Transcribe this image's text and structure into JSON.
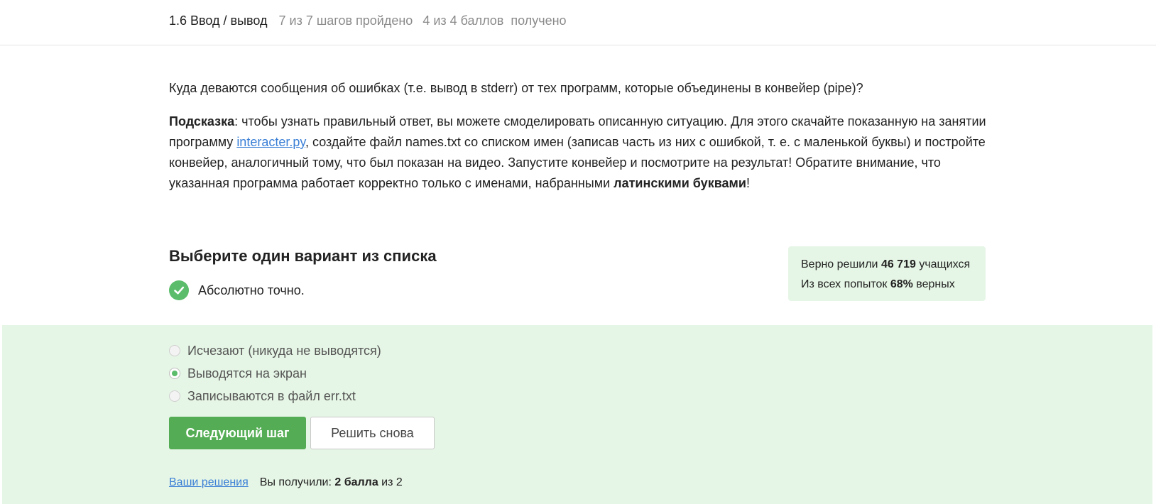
{
  "header": {
    "lesson": "1.6 Ввод / вывод",
    "steps": "7 из 7 шагов пройдено",
    "points": "4 из 4 баллов  получено"
  },
  "question": {
    "text": "Куда деваются сообщения об ошибках (т.е. вывод в stderr) от тех программ, которые объединены в конвейер (pipe)?"
  },
  "hint": {
    "label": "Подсказка",
    "part1": ": чтобы узнать правильный ответ, вы можете смоделировать описанную ситуацию. Для этого скачайте показанную на занятии программу ",
    "link": "interacter.py",
    "part2": ", создайте файл names.txt со списком имен (записав часть из них с ошибкой, т. е. с маленькой буквы) и постройте конвейер, аналогичный тому, что был показан на видео. Запустите конвейер и посмотрите на результат! Обратите внимание, что указанная программа работает корректно только с именами, набранными ",
    "bold_end": "латинскими буквами",
    "tail": "!"
  },
  "choose_title": "Выберите один вариант из списка",
  "feedback": {
    "text": "Абсолютно точно.",
    "icon": "check-circle-icon"
  },
  "stats": {
    "line1_prefix": "Верно решили ",
    "solved_count": "46 719",
    "line1_suffix": " учащихся",
    "line2_prefix": "Из всех попыток ",
    "percent": "68%",
    "line2_suffix": " верных"
  },
  "options": [
    {
      "label": "Исчезают (никуда не выводятся)",
      "selected": false
    },
    {
      "label": "Выводятся на экран",
      "selected": true
    },
    {
      "label": "Записываются в файл err.txt",
      "selected": false
    }
  ],
  "buttons": {
    "next": "Следующий шаг",
    "retry": "Решить снова"
  },
  "footer": {
    "solutions_link": "Ваши решения",
    "score_prefix": "Вы получили: ",
    "score": "2 балла",
    "score_suffix": " из 2"
  },
  "colors": {
    "accent": "#54ad54",
    "success_bg": "#e6f6e6",
    "link": "#3a7fd6"
  }
}
